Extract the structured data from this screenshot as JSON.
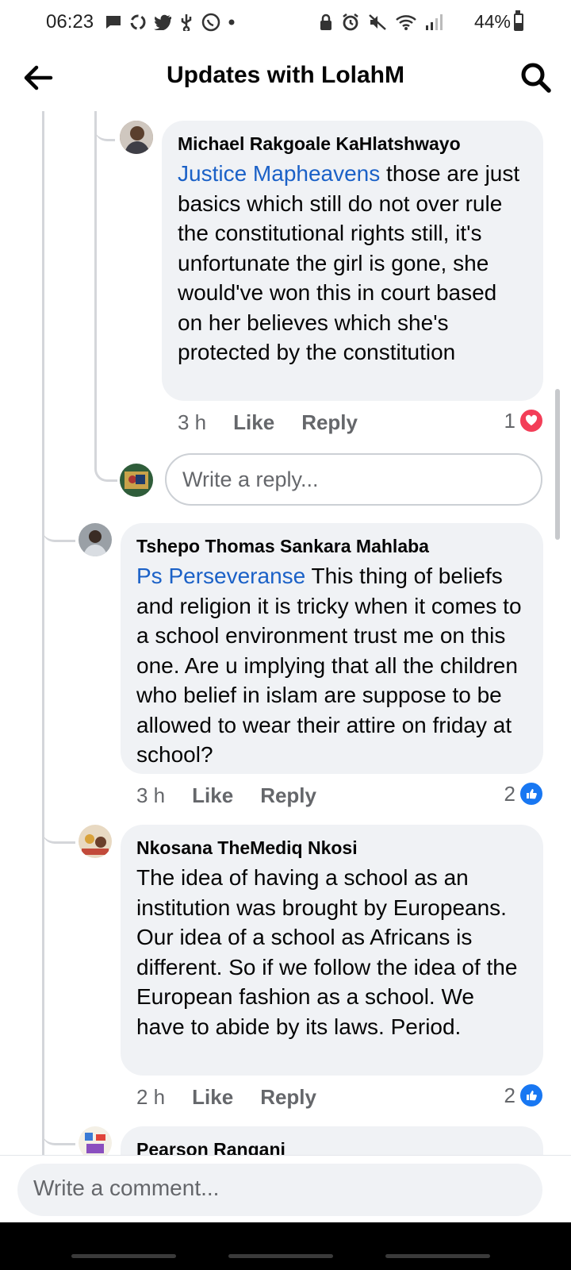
{
  "status_bar": {
    "time": "06:23",
    "battery": "44%",
    "battery_level": 0.44,
    "icons_left": [
      "message-icon",
      "sync-icon",
      "twitter-icon",
      "usb-icon",
      "whatsapp-icon",
      "dot-icon"
    ],
    "icons_right": [
      "lock-icon",
      "alarm-icon",
      "mute-icon",
      "wifi-icon",
      "signal-icon"
    ]
  },
  "header": {
    "title": "Updates with LolahM",
    "back_icon": "arrow-left-icon",
    "search_icon": "search-icon"
  },
  "comments": [
    {
      "author": "Michael Rakgoale KaHlatshwayo",
      "mention": "Justice Mapheavens",
      "text": " those are just basics which still do not over rule the constitutional rights still, it's unfortunate the girl is gone, she would've won this in court based on her believes which she's protected by the constitution",
      "time": "3 h",
      "like": "Like",
      "reply": "Reply",
      "reaction_count": "1",
      "reaction": "love",
      "reaction_color": "#f33e58"
    },
    {
      "author": "Tshepo Thomas Sankara Mahlaba",
      "mention": "Ps Perseveranse",
      "text": " This thing of beliefs and religion it is tricky when it comes to a school environment trust me on this one. Are u implying that all the children who belief in islam are suppose to be allowed to wear their attire on friday at school?",
      "time": "3 h",
      "like": "Like",
      "reply": "Reply",
      "reaction_count": "2",
      "reaction": "like",
      "reaction_color": "#1877f2"
    },
    {
      "author": "Nkosana TheMediq Nkosi",
      "mention": "",
      "text": "The idea of having a school as an institution was brought by Europeans. Our idea of a school as Africans is different. So if we follow the idea of the European fashion as a school. We have to abide by its laws. Period.",
      "time": "2 h",
      "like": "Like",
      "reply": "Reply",
      "reaction_count": "2",
      "reaction": "like",
      "reaction_color": "#1877f2"
    },
    {
      "author": "Pearson Rangani"
    }
  ],
  "reply_input": {
    "placeholder": "Write a reply..."
  },
  "composer": {
    "placeholder": "Write a comment..."
  },
  "colors": {
    "mention": "#1b61c7",
    "bubble": "#f0f2f5",
    "secondary_text": "#65676b"
  }
}
